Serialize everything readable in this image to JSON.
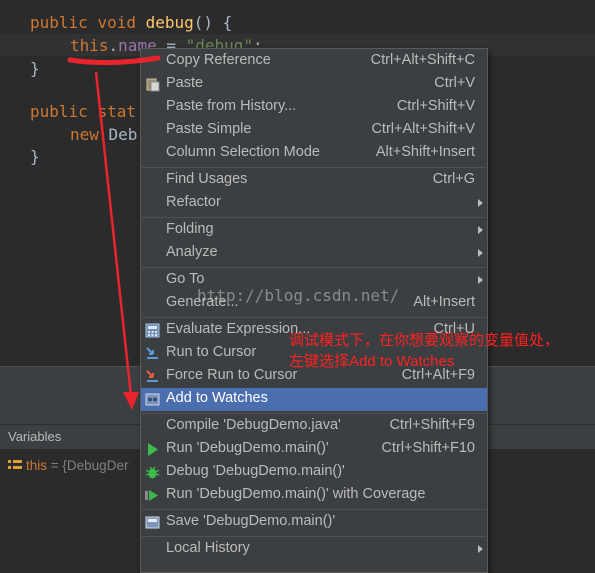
{
  "editor": {
    "line1": {
      "kw1": "public",
      "kw2": "void",
      "fn": "debug",
      "rest": "() {"
    },
    "line2": {
      "kw": "this",
      "dot": ".",
      "field": "name",
      "eq": " = ",
      "str": "\"debug\"",
      "end": ";"
    },
    "line3": "}",
    "line4": {
      "kw1": "public",
      "kw2": "stat"
    },
    "line5": {
      "kw": "new",
      "rest": " Deb"
    },
    "line6": "}"
  },
  "variables_panel": {
    "title": "Variables",
    "row": {
      "name": "this",
      "value": " = {DebugDer"
    }
  },
  "context_menu": {
    "items": [
      {
        "label": "Copy Reference",
        "shortcut": "Ctrl+Alt+Shift+C",
        "icon": "none"
      },
      {
        "label": "Paste",
        "shortcut": "Ctrl+V",
        "icon": "paste-icon"
      },
      {
        "label": "Paste from History...",
        "shortcut": "Ctrl+Shift+V",
        "icon": "none"
      },
      {
        "label": "Paste Simple",
        "shortcut": "Ctrl+Alt+Shift+V",
        "icon": "none"
      },
      {
        "label": "Column Selection Mode",
        "shortcut": "Alt+Shift+Insert",
        "icon": "none"
      },
      {
        "label": "Find Usages",
        "shortcut": "Ctrl+G",
        "icon": "none"
      },
      {
        "label": "Refactor",
        "shortcut": "",
        "icon": "none"
      },
      {
        "label": "Folding",
        "shortcut": "",
        "icon": "none"
      },
      {
        "label": "Analyze",
        "shortcut": "",
        "icon": "none"
      },
      {
        "label": "Go To",
        "shortcut": "",
        "icon": "none"
      },
      {
        "label": "Generate...",
        "shortcut": "Alt+Insert",
        "icon": "none"
      },
      {
        "label": "Evaluate Expression...",
        "shortcut": "Ctrl+U",
        "icon": "calculator-icon"
      },
      {
        "label": "Run to Cursor",
        "shortcut": "",
        "icon": "run-to-cursor-icon"
      },
      {
        "label": "Force Run to Cursor",
        "shortcut": "Ctrl+Alt+F9",
        "icon": "force-run-to-cursor-icon"
      },
      {
        "label": "Add to Watches",
        "shortcut": "",
        "icon": "watch-icon"
      },
      {
        "label": "Compile 'DebugDemo.java'",
        "shortcut": "Ctrl+Shift+F9",
        "icon": "none"
      },
      {
        "label": "Run 'DebugDemo.main()'",
        "shortcut": "Ctrl+Shift+F10",
        "icon": "run-icon"
      },
      {
        "label": "Debug 'DebugDemo.main()'",
        "shortcut": "",
        "icon": "debug-icon"
      },
      {
        "label": "Run 'DebugDemo.main()' with Coverage",
        "shortcut": "",
        "icon": "coverage-icon"
      },
      {
        "label": "Save 'DebugDemo.main()'",
        "shortcut": "",
        "icon": "save-config-icon"
      },
      {
        "label": "Local History",
        "shortcut": "",
        "icon": "none"
      }
    ],
    "selected": "Add to Watches"
  },
  "annotation": {
    "watermark": "http://blog.csdn.net/",
    "note_line1": "调试模式下，在你想要观察的变量值处，",
    "note_line2": "左键选择Add to Watches"
  },
  "colors": {
    "editor_bg": "#2b2b2b",
    "menu_bg": "#3c3f41",
    "selection": "#4b6eaf",
    "annotation_red": "#ff2020",
    "keyword": "#cc7832",
    "function": "#ffc66d",
    "field": "#9876aa",
    "string": "#6a8759"
  }
}
